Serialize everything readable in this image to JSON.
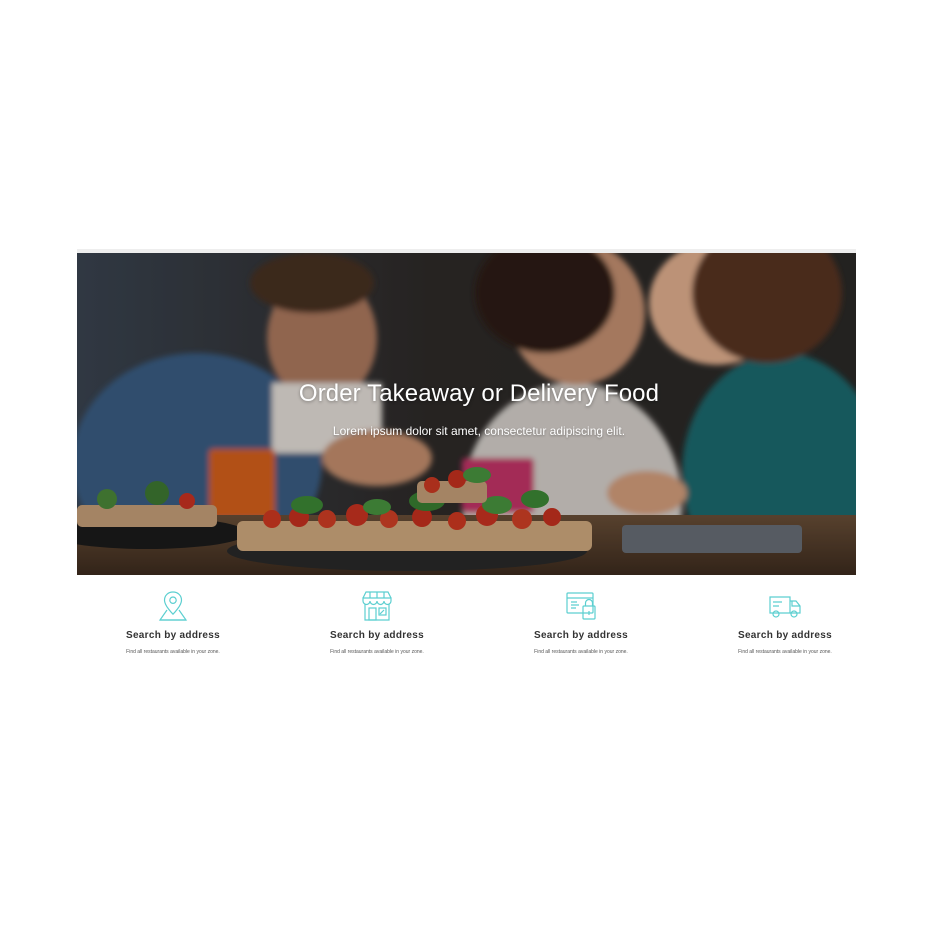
{
  "colors": {
    "accent": "#5ccfd0",
    "hero_dark": "#2e2a26",
    "title_text": "#333333"
  },
  "hero": {
    "title": "Order Takeaway or Delivery Food",
    "subtitle": "Lorem ipsum dolor sit amet, consectetur adipiscing elit."
  },
  "features": [
    {
      "icon": "map-pin-icon",
      "title": "Search by address",
      "description": "Find all restaurants available in your zone."
    },
    {
      "icon": "storefront-icon",
      "title": "Search by address",
      "description": "Find all restaurants available in your zone."
    },
    {
      "icon": "secure-payment-icon",
      "title": "Search by address",
      "description": "Find all restaurants available in your zone."
    },
    {
      "icon": "delivery-truck-icon",
      "title": "Search by address",
      "description": "Find all restaurants available in your zone."
    }
  ]
}
